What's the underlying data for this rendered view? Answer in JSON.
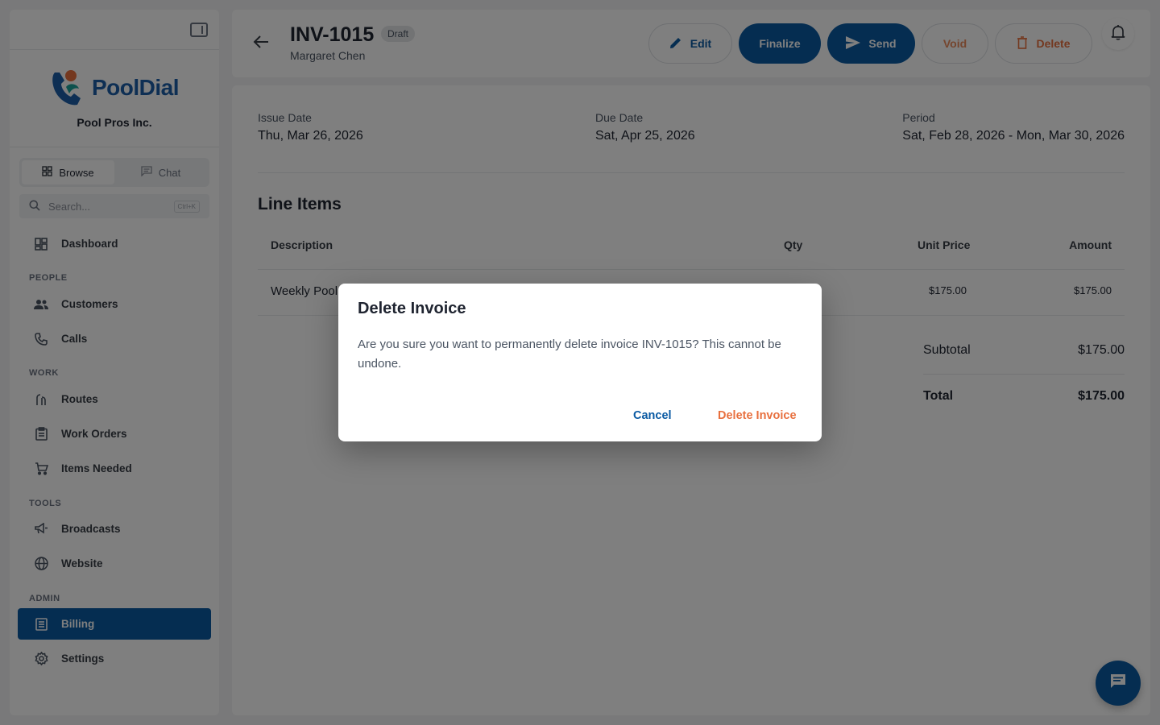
{
  "sidebar": {
    "brand": "PoolDial",
    "org_name": "Pool Pros Inc.",
    "tabs": [
      {
        "label": "Browse",
        "icon": "grid-icon",
        "active": true
      },
      {
        "label": "Chat",
        "icon": "chat-icon",
        "active": false
      }
    ],
    "search": {
      "placeholder": "Search...",
      "shortcut": "Ctrl+K"
    },
    "dashboard": {
      "label": "Dashboard",
      "icon": "dashboard-icon"
    },
    "sections": [
      {
        "label": "PEOPLE",
        "items": [
          {
            "label": "Customers",
            "icon": "people-icon"
          },
          {
            "label": "Calls",
            "icon": "phone-icon"
          }
        ]
      },
      {
        "label": "WORK",
        "items": [
          {
            "label": "Routes",
            "icon": "route-icon"
          },
          {
            "label": "Work Orders",
            "icon": "clipboard-icon"
          },
          {
            "label": "Items Needed",
            "icon": "cart-icon"
          }
        ]
      },
      {
        "label": "TOOLS",
        "items": [
          {
            "label": "Broadcasts",
            "icon": "megaphone-icon"
          },
          {
            "label": "Website",
            "icon": "globe-icon"
          }
        ]
      },
      {
        "label": "ADMIN",
        "items": [
          {
            "label": "Billing",
            "icon": "billing-icon",
            "active": true
          },
          {
            "label": "Settings",
            "icon": "gear-icon"
          }
        ]
      }
    ]
  },
  "header": {
    "invoice_number": "INV-1015",
    "status": "Draft",
    "customer": "Margaret Chen",
    "buttons": {
      "edit": "Edit",
      "finalize": "Finalize",
      "send": "Send",
      "void": "Void",
      "delete": "Delete"
    }
  },
  "invoice": {
    "issue_date": {
      "label": "Issue Date",
      "value": "Thu, Mar 26, 2026"
    },
    "due_date": {
      "label": "Due Date",
      "value": "Sat, Apr 25, 2026"
    },
    "period": {
      "label": "Period",
      "value": "Sat, Feb 28, 2026 - Mon, Mar 30, 2026"
    },
    "line_items_title": "Line Items",
    "columns": [
      "Description",
      "Qty",
      "Unit Price",
      "Amount"
    ],
    "rows": [
      {
        "description": "Weekly Pool",
        "qty": "",
        "unit_price": "$175.00",
        "amount": "$175.00"
      }
    ],
    "subtotal": {
      "label": "Subtotal",
      "value": "$175.00"
    },
    "total": {
      "label": "Total",
      "value": "$175.00"
    }
  },
  "dialog": {
    "title": "Delete Invoice",
    "message": "Are you sure you want to permanently delete invoice INV-1015? This cannot be undone.",
    "cancel": "Cancel",
    "confirm": "Delete Invoice"
  },
  "colors": {
    "primary": "#0a5aa3",
    "danger": "#e8703f",
    "brand_orange": "#e8703f",
    "brand_teal": "#1aa39a"
  }
}
